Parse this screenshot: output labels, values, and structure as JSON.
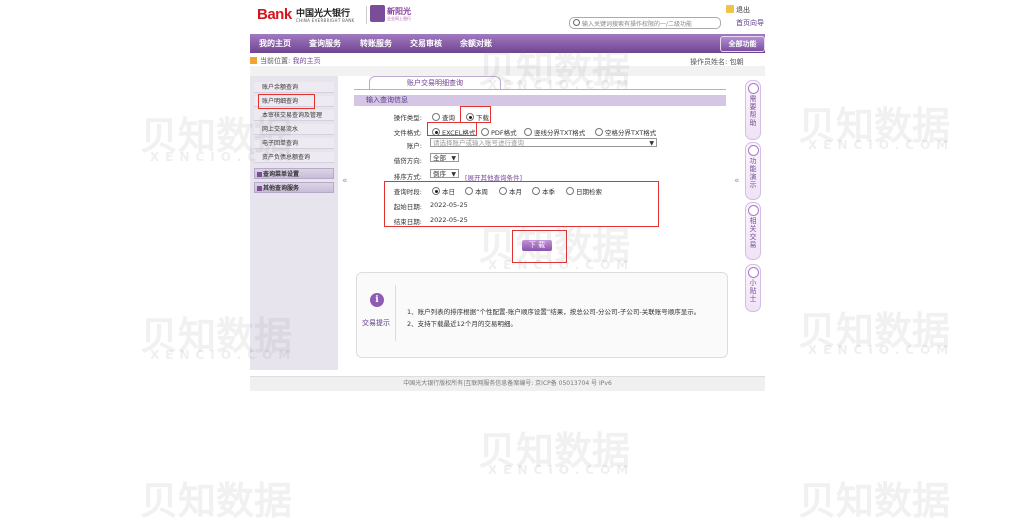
{
  "header": {
    "bank_text": "Bank",
    "bank_cn": "中国光大银行",
    "bank_en": "CHINA EVERBRIGHT BANK",
    "badge_cn": "新阳光",
    "badge_sub": "企业网上银行",
    "search_placeholder": "输入关键词搜索有操作权限的一/二级功能",
    "exit_label": "退出",
    "home_label": "首页向导"
  },
  "nav": {
    "items": [
      "我的主页",
      "查询服务",
      "转账服务",
      "交易审核",
      "余额对账"
    ],
    "all_functions": "全部功能"
  },
  "breadcrumb": {
    "prefix": "当前位置:",
    "current": "我的主页"
  },
  "operator": "操作员姓名: 包朝",
  "sidebar": {
    "items": [
      "账户余额查询",
      "账户明细查询",
      "本审核交易查询及管理",
      "网上交易流水",
      "电子回单查询",
      "资产负债总额查询"
    ],
    "groups": [
      "查询菜单设置",
      "其他查询服务"
    ],
    "collapse": "«"
  },
  "main": {
    "tab": "账户交易明细查询",
    "section": "输入查询信息",
    "op_type_label": "操作类型:",
    "op_options": [
      "查询",
      "下载"
    ],
    "file_format_label": "文件格式:",
    "file_options": [
      "EXCEL格式",
      "PDF格式",
      "竖线分界TXT格式",
      "空格分界TXT格式"
    ],
    "account_label": "账户:",
    "account_placeholder": "请选择账户或输入账号进行查询",
    "direction_label": "借贷方向:",
    "direction_value": "全部",
    "sort_label": "排序方式:",
    "sort_value": "倒序",
    "more_link": "[展开其他查询条件]",
    "period_label": "查询时段:",
    "period_options": [
      "本日",
      "本周",
      "本月",
      "本季",
      "日期检索"
    ],
    "start_label": "起始日期:",
    "start_value": "2022-05-25",
    "end_label": "结束日期:",
    "end_value": "2022-05-25",
    "download_btn": "下 载",
    "collapse_right": "«"
  },
  "tips": {
    "label": "交易提示",
    "icon": "i",
    "lines": [
      "1、账户列表的排序根据“个性配置-账户顺序设置”结果，按总公司-分公司-子公司-关联账号顺序显示。",
      "2、支持下载最近12个月的交易明细。"
    ]
  },
  "right_help": [
    "需要帮助",
    "功能演示",
    "相关交易",
    "小贴士"
  ],
  "footer": "中国光大银行版权所有|互联网服务信息备案编号: 京ICP备 05013704 号 IPv6",
  "watermark": {
    "cn": "贝知数据",
    "en": "XENCIO.COM"
  }
}
